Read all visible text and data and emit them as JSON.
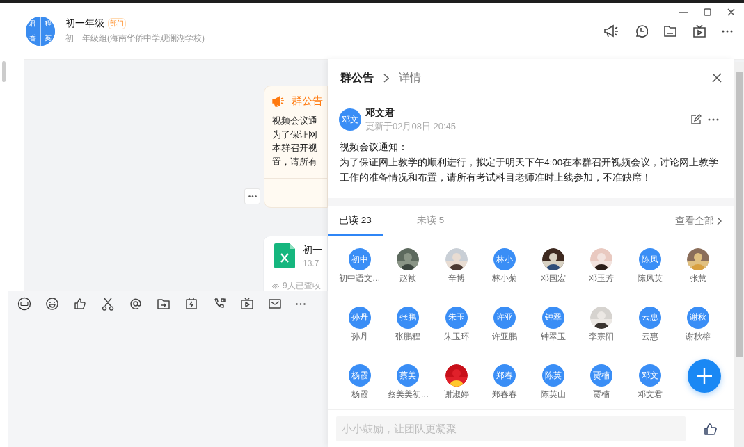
{
  "header": {
    "group_avatar": [
      "君",
      "程",
      "香",
      "英"
    ],
    "title": "初一年级",
    "badge": "部门",
    "subtitle": "初一年级组(海南华侨中学观澜湖学校)"
  },
  "chat": {
    "announcement_card": {
      "title": "群公告",
      "lines": [
        "视频会议通",
        "为了保证网",
        "本群召开视",
        "置，请所有"
      ]
    },
    "file_card": {
      "name": "初一",
      "size": "13.7",
      "viewed": "9人已查收"
    }
  },
  "panel": {
    "breadcrumb": [
      "群公告",
      "详情"
    ],
    "author": {
      "avatar_text": "邓文",
      "name": "邓文君",
      "updated": "更新于02月08日 20:45"
    },
    "body": [
      "视频会议通知：",
      "为了保证网上教学的顺利进行，拟定于明天下午4:00在本群召开视频会议，讨论网上教学工作的准备情况和布置，请所有考试科目老师准时上线参加，不准缺席！"
    ],
    "tabs": [
      {
        "label": "已读 23",
        "selected": true
      },
      {
        "label": "未读 5",
        "selected": false
      }
    ],
    "view_all": "查看全部",
    "members": [
      {
        "kind": "text",
        "avatar_text": "初中",
        "name": "初中语文…"
      },
      {
        "kind": "picture",
        "name": "赵祯"
      },
      {
        "kind": "picture",
        "name": "辛博"
      },
      {
        "kind": "text",
        "avatar_text": "林小",
        "name": "林小菊"
      },
      {
        "kind": "picture",
        "name": "邓国宏"
      },
      {
        "kind": "picture",
        "name": "邓玉芳"
      },
      {
        "kind": "text",
        "avatar_text": "陈凤",
        "name": "陈凤英"
      },
      {
        "kind": "picture",
        "name": "张慧"
      },
      {
        "kind": "text",
        "avatar_text": "孙丹",
        "name": "孙丹"
      },
      {
        "kind": "text",
        "avatar_text": "张鹏",
        "name": "张鹏程"
      },
      {
        "kind": "text",
        "avatar_text": "朱玉",
        "name": "朱玉环"
      },
      {
        "kind": "text",
        "avatar_text": "许亚",
        "name": "许亚鹏"
      },
      {
        "kind": "text",
        "avatar_text": "钟翠",
        "name": "钟翠玉"
      },
      {
        "kind": "picture",
        "name": "李宗阳"
      },
      {
        "kind": "text",
        "avatar_text": "云惠",
        "name": "云惠"
      },
      {
        "kind": "text",
        "avatar_text": "谢秋",
        "name": "谢秋榕"
      },
      {
        "kind": "text",
        "avatar_text": "杨霞",
        "name": "杨霞"
      },
      {
        "kind": "text",
        "avatar_text": "蔡美",
        "name": "蔡美美初…"
      },
      {
        "kind": "picture",
        "name": "谢淑婷"
      },
      {
        "kind": "text",
        "avatar_text": "郑春",
        "name": "郑春春"
      },
      {
        "kind": "text",
        "avatar_text": "陈英",
        "name": "陈英山"
      },
      {
        "kind": "text",
        "avatar_text": "贾楠",
        "name": "贾楠"
      },
      {
        "kind": "text",
        "avatar_text": "邓文",
        "name": "邓文君"
      }
    ],
    "comment": {
      "placeholder": "小小鼓励，让团队更凝聚"
    }
  }
}
